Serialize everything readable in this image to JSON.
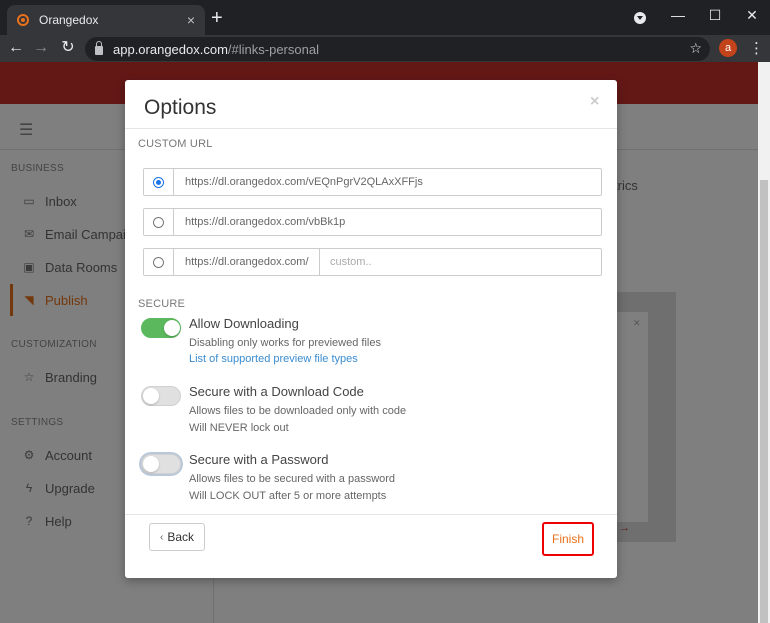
{
  "browser": {
    "tab_title": "Orangedox",
    "tab_close": "×",
    "new_tab": "+",
    "url_host": "app.orangedox.com",
    "url_path": "/#links-personal",
    "avatar_letter": "a",
    "minimize": "—",
    "maximize": "☐",
    "close": "✕"
  },
  "page": {
    "banner_text": "",
    "content_title": "",
    "metrics_label": "trics",
    "sidebar": {
      "sections": [
        {
          "label": "BUSINESS"
        },
        {
          "label": "CUSTOMIZATION"
        },
        {
          "label": "SETTINGS"
        }
      ],
      "items": [
        {
          "label": "Inbox",
          "icon": "inbox-icon"
        },
        {
          "label": "Email Campaig",
          "icon": "envelope-icon"
        },
        {
          "label": "Data Rooms",
          "icon": "image-icon"
        },
        {
          "label": "Publish",
          "icon": "rss-icon",
          "active": true
        },
        {
          "label": "Branding",
          "icon": "star-icon"
        },
        {
          "label": "Account",
          "icon": "gear-icon"
        },
        {
          "label": "Upgrade",
          "icon": "bolt-icon"
        },
        {
          "label": "Help",
          "icon": "question-icon"
        }
      ]
    }
  },
  "modal": {
    "title": "Options",
    "close": "×",
    "custom_url_label": "CUSTOM URL",
    "url_options": [
      {
        "value": "https://dl.orangedox.com/vEQnPgrV2QLAxXFFjs",
        "checked": true
      },
      {
        "value": "https://dl.orangedox.com/vbBk1p",
        "checked": false
      }
    ],
    "custom_url": {
      "prefix": "https://dl.orangedox.com/",
      "placeholder": "custom.."
    },
    "secure_label": "SECURE",
    "toggles": [
      {
        "title": "Allow Downloading",
        "desc1": "Disabling only works for previewed files",
        "link": "List of supported preview file types",
        "on": true
      },
      {
        "title": "Secure with a Download Code",
        "desc1": "Allows files to be downloaded only with code",
        "desc2": "Will NEVER lock out",
        "on": false
      },
      {
        "title": "Secure with a Password",
        "desc1": "Allows files to be secured with a password",
        "desc2": "Will LOCK OUT after 5 or more attempts",
        "on": false
      }
    ],
    "back_label": "Back",
    "finish_label": "Finish"
  },
  "colors": {
    "accent": "#e8711a",
    "toggle_on": "#5cb85c",
    "banner": "#c9302c",
    "highlight": "#ee0000"
  }
}
